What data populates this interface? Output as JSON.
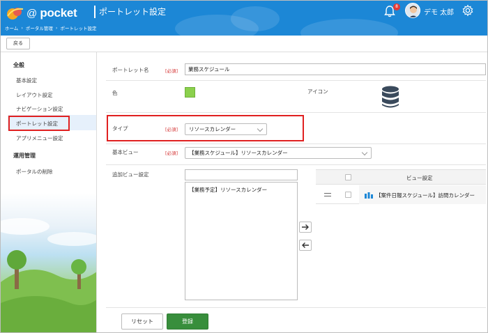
{
  "header": {
    "logo_at": "@",
    "logo_word": "pocket",
    "page_title": "ポートレット設定",
    "notification_count": "8",
    "user_name": "デモ 太郎"
  },
  "breadcrumb": [
    "ホーム",
    "ポータル管理",
    "ポートレット設定"
  ],
  "toolbar": {
    "back_label": "戻る"
  },
  "sidebar": {
    "general_heading": "全般",
    "general_items": [
      "基本設定",
      "レイアウト設定",
      "ナビゲーション設定",
      "ポートレット設定",
      "アプリメニュー設定"
    ],
    "ops_heading": "運用管理",
    "ops_items": [
      "ポータルの削除"
    ]
  },
  "form": {
    "required_label": "[必須]",
    "name_label": "ポートレット名",
    "name_value": "業務スケジュール",
    "color_label": "色",
    "color_value": "#8bd04d",
    "icon_label": "アイコン",
    "icon_name": "database-icon",
    "type_label": "タイプ",
    "type_value": "リソースカレンダー",
    "base_view_label": "基本ビュー",
    "base_view_value": "【業務スケジュール】リソースカレンダー",
    "additional_view_label": "追加ビュー設定",
    "available_views": [
      "【業務予定】リソースカレンダー"
    ],
    "view_table_header": "ビュー設定",
    "selected_views": [
      "【案件日報スケジュール】訪問カレンダー"
    ]
  },
  "actions": {
    "reset_label": "リセット",
    "submit_label": "登録"
  }
}
